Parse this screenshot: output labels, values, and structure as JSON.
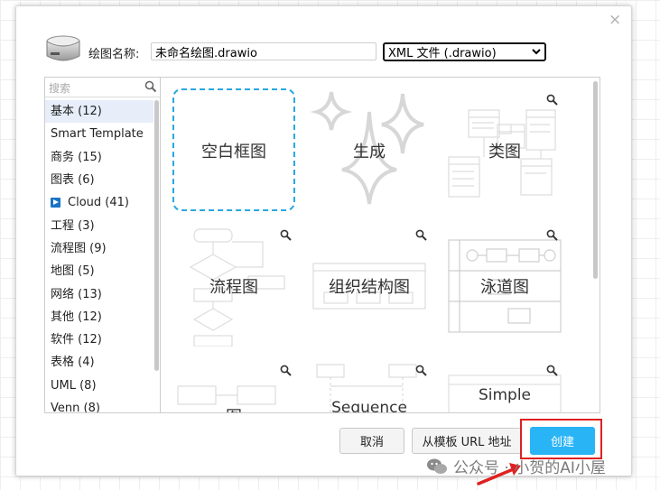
{
  "dialog": {
    "close_glyph": "×",
    "filename_label": "绘图名称:",
    "filename_value": "未命名绘图.drawio",
    "format_value": "XML 文件 (.drawio)"
  },
  "sidebar": {
    "search_placeholder": "搜索",
    "categories": [
      {
        "label": "基本 (12)"
      },
      {
        "label": "Smart Template"
      },
      {
        "label": "商务 (15)"
      },
      {
        "label": "图表 (6)"
      },
      {
        "label": "Cloud (41)",
        "icon": "cloud-play-icon"
      },
      {
        "label": "工程 (3)"
      },
      {
        "label": "流程图 (9)"
      },
      {
        "label": "地图 (5)"
      },
      {
        "label": "网络 (13)"
      },
      {
        "label": "其他 (12)"
      },
      {
        "label": "软件 (12)"
      },
      {
        "label": "表格 (4)"
      },
      {
        "label": "UML (8)"
      },
      {
        "label": "Venn (8)"
      }
    ],
    "selected_index": 0
  },
  "templates": [
    {
      "label": "空白框图"
    },
    {
      "label": "生成"
    },
    {
      "label": "类图"
    },
    {
      "label": "流程图"
    },
    {
      "label": "组织结构图"
    },
    {
      "label": "泳道图"
    },
    {
      "label": "图"
    },
    {
      "label": "Sequence"
    },
    {
      "label": "Simple"
    }
  ],
  "buttons": {
    "cancel": "取消",
    "from_url": "从模板 URL 地址",
    "create": "创建"
  },
  "watermark": {
    "text": "公众号 · 小贺的AI小屋"
  },
  "colors": {
    "accent": "#29b4f6",
    "dashed_border": "#29a8e0",
    "highlight": "#e02020"
  }
}
